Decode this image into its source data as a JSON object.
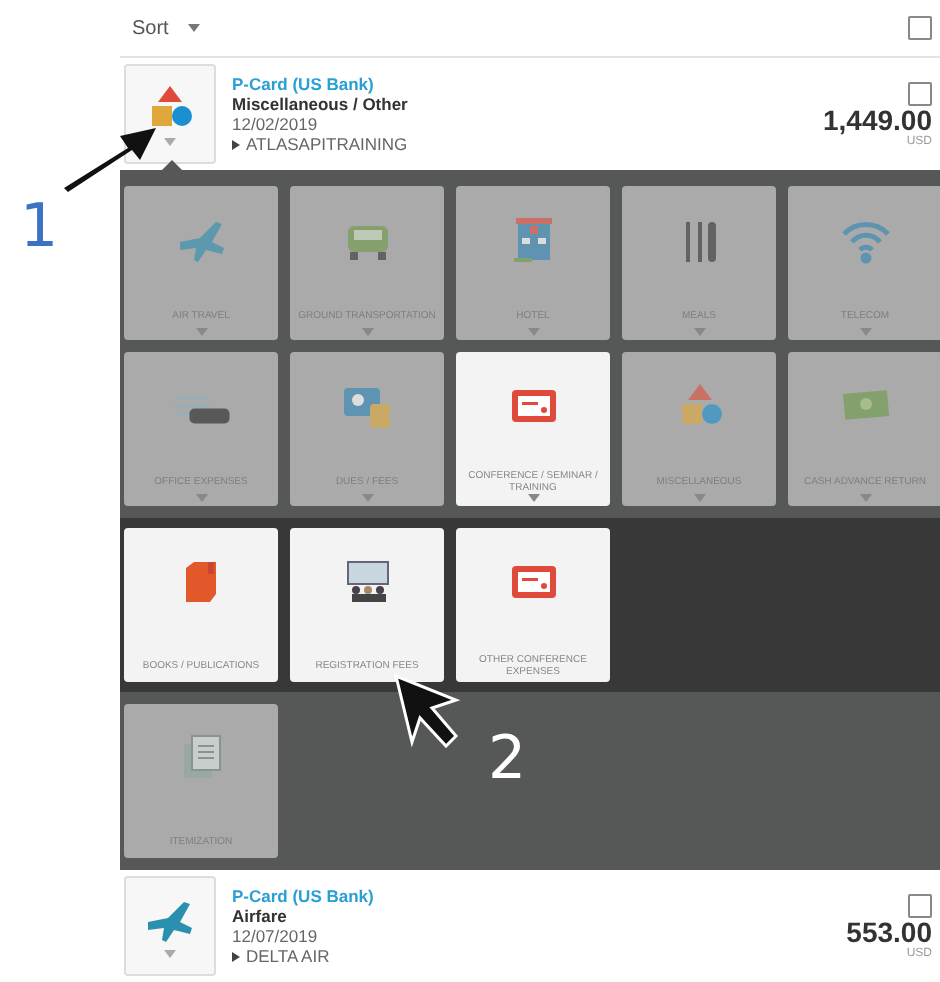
{
  "sort": {
    "label": "Sort",
    "checked": false
  },
  "transactions": [
    {
      "card": "P-Card (US Bank)",
      "category": "Miscellaneous / Other",
      "date": "12/02/2019",
      "merchant": "ATLASAPITRAINING",
      "amount": "1,449.00",
      "currency": "USD",
      "checked": false,
      "expanded": true
    },
    {
      "card": "P-Card (US Bank)",
      "category": "Airfare",
      "date": "12/07/2019",
      "merchant": "DELTA AIR",
      "amount": "553.00",
      "currency": "USD",
      "checked": false,
      "expanded": false
    }
  ],
  "categories": [
    {
      "label": "AIR TRAVEL",
      "selected": false
    },
    {
      "label": "GROUND TRANSPORTATION",
      "selected": false
    },
    {
      "label": "HOTEL",
      "selected": false
    },
    {
      "label": "MEALS",
      "selected": false
    },
    {
      "label": "TELECOM",
      "selected": false
    },
    {
      "label": "OFFICE EXPENSES",
      "selected": false
    },
    {
      "label": "DUES / FEES",
      "selected": false
    },
    {
      "label": "CONFERENCE / SEMINAR / TRAINING",
      "selected": true
    },
    {
      "label": "MISCELLANEOUS",
      "selected": false
    },
    {
      "label": "CASH ADVANCE RETURN",
      "selected": false
    }
  ],
  "subcategories": [
    {
      "label": "BOOKS / PUBLICATIONS"
    },
    {
      "label": "REGISTRATION FEES"
    },
    {
      "label": "OTHER CONFERENCE EXPENSES"
    }
  ],
  "extra_tiles": [
    {
      "label": "ITEMIZATION",
      "selected": false
    }
  ],
  "annotations": [
    {
      "label": "1",
      "kind": "blue"
    },
    {
      "label": "2",
      "kind": "white"
    }
  ]
}
